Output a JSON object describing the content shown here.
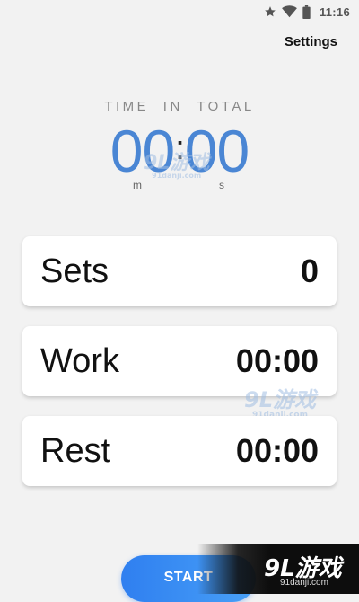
{
  "status_bar": {
    "time": "11:16",
    "icons": [
      "star-icon",
      "wifi-icon",
      "battery-icon"
    ]
  },
  "header": {
    "settings_label": "Settings"
  },
  "total": {
    "label": "TIME IN TOTAL",
    "minutes": "00",
    "separator": ":",
    "seconds": "00",
    "minutes_unit": "m",
    "seconds_unit": "s"
  },
  "cards": {
    "sets": {
      "label": "Sets",
      "value": "0"
    },
    "work": {
      "label": "Work",
      "value": "00:00"
    },
    "rest": {
      "label": "Rest",
      "value": "00:00"
    }
  },
  "start_button": {
    "label": "START"
  },
  "watermark": {
    "logo_text": "9L游戏",
    "site": "91danji.com"
  },
  "colors": {
    "accent": "#4a86d4",
    "button": "#2f7ff0",
    "background": "#f2f2f2"
  }
}
